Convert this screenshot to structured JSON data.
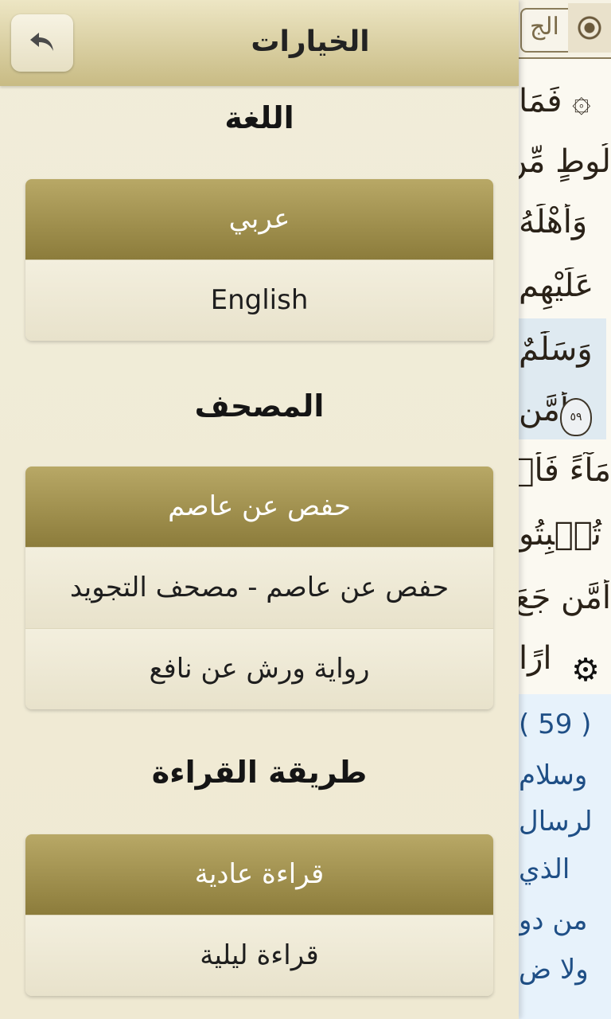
{
  "header": {
    "title": "الخيارات",
    "back_icon": "back-arrow-icon"
  },
  "language": {
    "title": "اللغة",
    "options": [
      {
        "label": "عربي",
        "selected": true
      },
      {
        "label": "English",
        "selected": false
      }
    ]
  },
  "mushaf": {
    "title": "المصحف",
    "options": [
      {
        "label": "حفص عن عاصم",
        "selected": true
      },
      {
        "label": "حفص عن عاصم - مصحف التجويد",
        "selected": false
      },
      {
        "label": "رواية ورش عن نافع",
        "selected": false
      }
    ]
  },
  "reading_mode": {
    "title": "طريقة القراءة",
    "options": [
      {
        "label": "قراءة عادية",
        "selected": true
      },
      {
        "label": "قراءة ليلية",
        "selected": false
      }
    ]
  },
  "background_page": {
    "surah_header": "الج",
    "lines": [
      "۞ فَمَا",
      "لُوطٍ مِّن",
      "وَأَهْلَهُ",
      "عَلَيْهِم",
      "وَسَلَٰمٌ",
      "أَمَّن",
      "مَآءً فَأَنۢ",
      "تُنۢبِتُو",
      "أَمَّن جَعَ",
      "ارًا"
    ],
    "ayah_number": "٥٩",
    "tafsir_lines": [
      "( 59 )",
      "وسلام",
      "لرسال",
      "الذي",
      "من دو",
      "ولا ض"
    ],
    "colors": {
      "tafsir_text": "#1f4f86",
      "tafsir_bg": "#e7f2fb",
      "selected_option": "#a1914f"
    }
  }
}
